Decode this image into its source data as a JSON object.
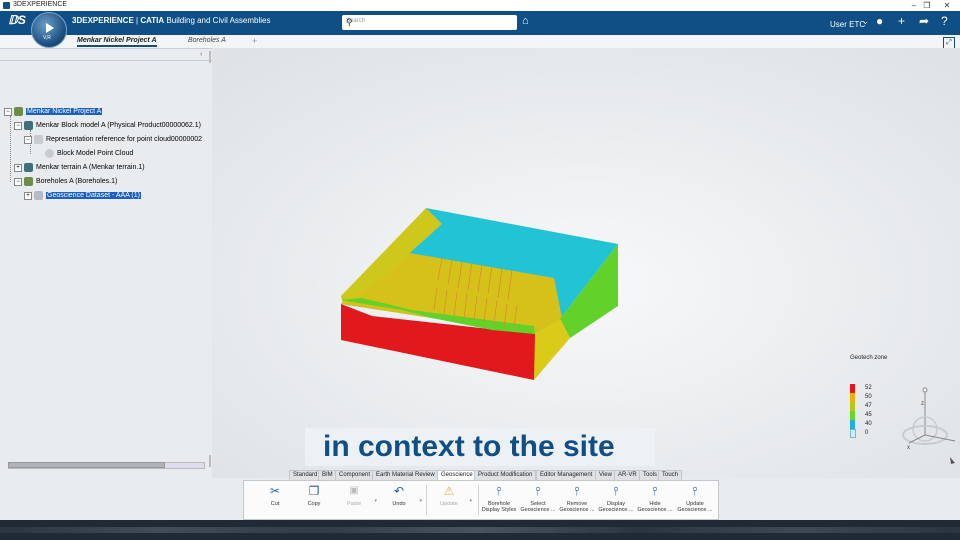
{
  "window": {
    "app_name": "3DEXPERIENCE"
  },
  "header": {
    "brand_bold": "3DEXPERIENCE",
    "brand_sep": " | ",
    "brand_app": "CATIA",
    "brand_role": "Building and Civil Assemblies",
    "search_placeholder": "Search",
    "user_name": "User ETC",
    "compass_label": "V,R"
  },
  "tabs": [
    {
      "label": "Menkar Nickel Project A",
      "active": true
    },
    {
      "label": "Boreholes A",
      "active": false
    }
  ],
  "tree": {
    "root": "Menkar Nickel Project A",
    "block_model": "Menkar Block model A (Physical Product00000062.1)",
    "representation": "Representation reference for point cloud00000002",
    "point_cloud": "Block Model Point Cloud",
    "terrain": "Menkar terrain A (Menkar terrain.1)",
    "boreholes": "Boreholes A (Boreholes.1)",
    "dataset": "Geoscience Dataset - AAA (1)"
  },
  "legend": {
    "title": "Geotech zone",
    "entries": [
      {
        "value": "52",
        "color": "#e3161a"
      },
      {
        "value": "50",
        "color": "#e8b400"
      },
      {
        "value": "47",
        "color": "#b9c71a"
      },
      {
        "value": "45",
        "color": "#6ad42a"
      },
      {
        "value": "40",
        "color": "#1fb0d8"
      },
      {
        "value": "0",
        "color": "#c9eef8"
      }
    ]
  },
  "caption": "in context to the site",
  "action_bar": {
    "tabs": [
      "Standard",
      "BIM",
      "Component",
      "Earth Material Review",
      "Geoscience",
      "Product Modification",
      "Editor Management",
      "View",
      "AR-VR",
      "Tools",
      "Touch"
    ],
    "active_tab": "Geoscience",
    "tools": [
      {
        "label": "Cut",
        "icon": "scissors-icon",
        "glyph": "✂"
      },
      {
        "label": "Copy",
        "icon": "copy-icon",
        "glyph": "❐"
      },
      {
        "label": "Paste",
        "icon": "paste-icon",
        "glyph": "📋"
      },
      {
        "label": "Undo",
        "icon": "undo-icon",
        "glyph": "↶"
      },
      {
        "label": "Update",
        "icon": "update-icon",
        "glyph": "⚠"
      },
      {
        "label": "Borehole Display Styles",
        "label1": "Borehole",
        "label2": "Display Styles"
      },
      {
        "label1": "Select",
        "label2": "Geoscience ..."
      },
      {
        "label1": "Remove",
        "label2": "Geoscience ..."
      },
      {
        "label1": "Display",
        "label2": "Geoscience ..."
      },
      {
        "label1": "Hide",
        "label2": "Geoscience ..."
      },
      {
        "label1": "Update",
        "label2": "Geoscience ..."
      }
    ]
  },
  "compass_axes": {
    "z": "z",
    "x": "x"
  }
}
